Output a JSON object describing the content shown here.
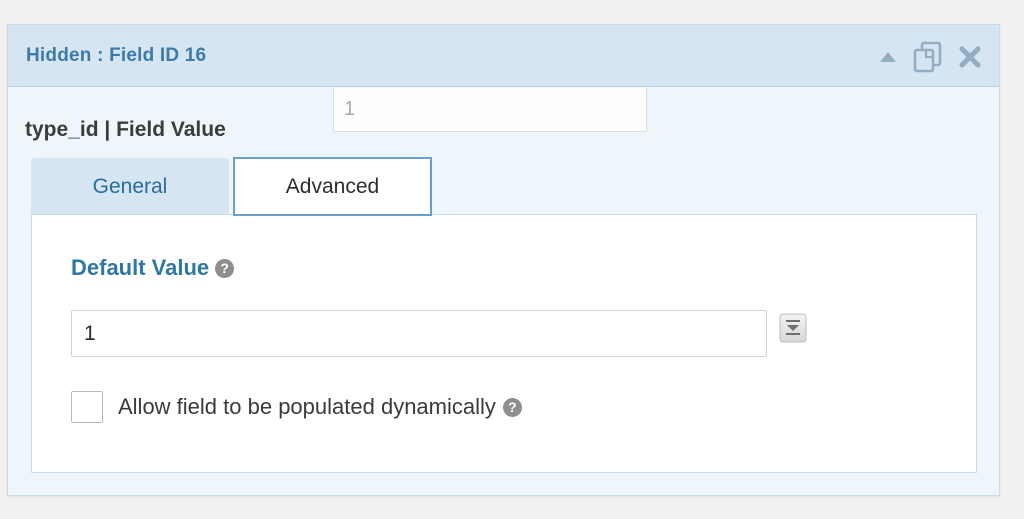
{
  "header": {
    "title": "Hidden : Field ID 16",
    "icons": [
      "collapse-arrow-icon",
      "duplicate-icon",
      "delete-icon"
    ],
    "accent_color": "#3e7aa8"
  },
  "field": {
    "label": "type_id | Field Value",
    "preview_value": "1"
  },
  "tabs": [
    {
      "label": "General",
      "active": false
    },
    {
      "label": "Advanced",
      "active": true
    }
  ],
  "advanced": {
    "default_value_label": "Default Value",
    "default_value": "1",
    "help_icon": "help-icon",
    "merge_tag_icon": "merge-tags-icon",
    "dynamic_population": {
      "label": "Allow field to be populated dynamically",
      "checked": false
    }
  }
}
